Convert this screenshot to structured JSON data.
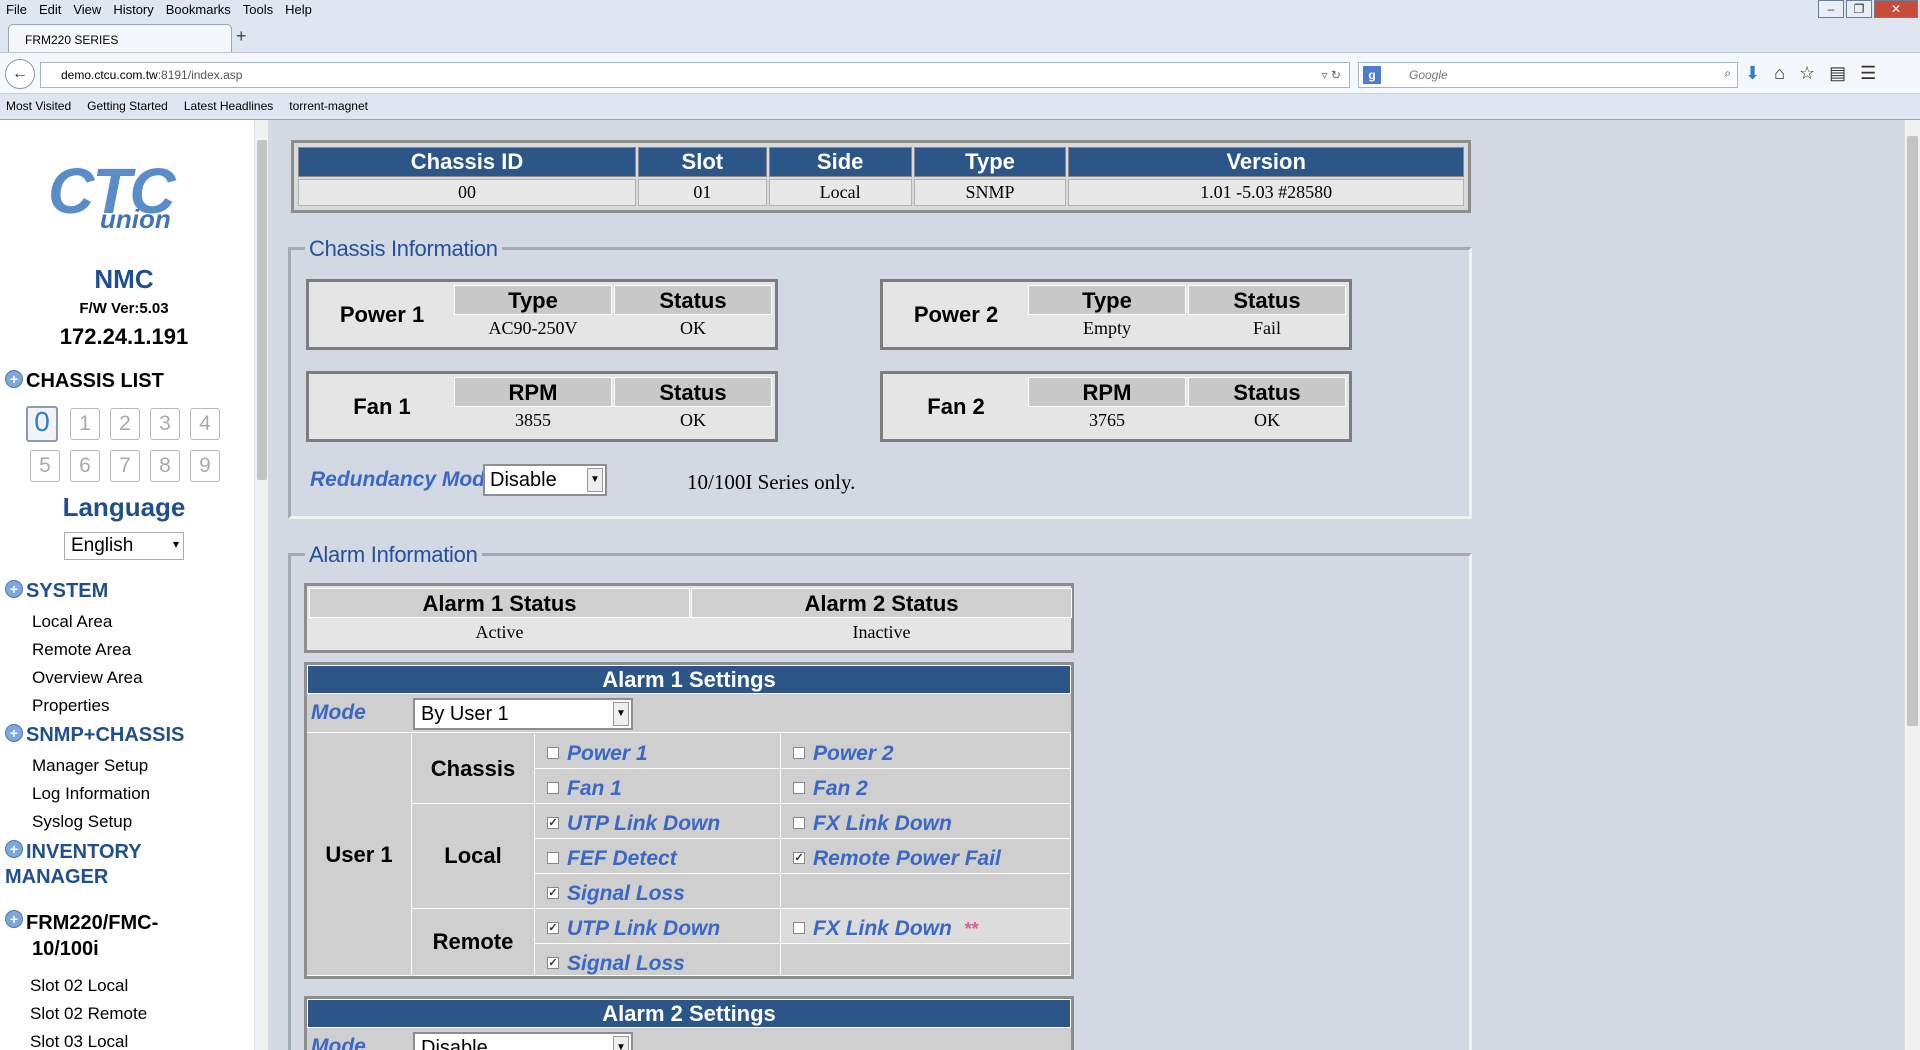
{
  "browser": {
    "menu": [
      "File",
      "Edit",
      "View",
      "History",
      "Bookmarks",
      "Tools",
      "Help"
    ],
    "tab_title": "FRM220 SERIES",
    "url_host": "demo.ctcu.com.tw",
    "url_rest": ":8191/index.asp",
    "search_placeholder": "Google",
    "bookmarks": [
      "Most Visited",
      "Getting Started",
      "Latest Headlines",
      "torrent-magnet"
    ]
  },
  "sidebar": {
    "logo_top": "CTC",
    "logo_bottom": "union",
    "nmc": "NMC",
    "fw": "F/W Ver:5.03",
    "ip": "172.24.1.191",
    "chassis_list": "CHASSIS LIST",
    "chassis_numbers": [
      "0",
      "1",
      "2",
      "3",
      "4",
      "5",
      "6",
      "7",
      "8",
      "9"
    ],
    "language_title": "Language",
    "language_value": "English",
    "system": "SYSTEM",
    "system_items": [
      "Local Area",
      "Remote Area",
      "Overview Area",
      "Properties"
    ],
    "snmp": "SNMP+CHASSIS",
    "snmp_items": [
      "Manager Setup",
      "Log Information",
      "Syslog Setup"
    ],
    "inventory_line1": "INVENTORY",
    "inventory_line2": "MANAGER",
    "frm_line1": "FRM220/FMC-",
    "frm_line2": "10/100i",
    "frm_items": [
      "Slot 02 Local",
      "Slot 02 Remote",
      "Slot 03 Local"
    ]
  },
  "header_table": {
    "headers": [
      "Chassis ID",
      "Slot",
      "Side",
      "Type",
      "Version"
    ],
    "values": [
      "00",
      "01",
      "Local",
      "SNMP",
      "1.01 -5.03 #28580"
    ]
  },
  "chassis_info": {
    "legend": "Chassis Information",
    "power1": {
      "name": "Power 1",
      "h1": "Type",
      "h2": "Status",
      "v1": "AC90-250V",
      "v2": "OK"
    },
    "power2": {
      "name": "Power 2",
      "h1": "Type",
      "h2": "Status",
      "v1": "Empty",
      "v2": "Fail"
    },
    "fan1": {
      "name": "Fan 1",
      "h1": "RPM",
      "h2": "Status",
      "v1": "3855",
      "v2": "OK"
    },
    "fan2": {
      "name": "Fan 2",
      "h1": "RPM",
      "h2": "Status",
      "v1": "3765",
      "v2": "OK"
    },
    "redundancy_label": "Redundancy Mode",
    "redundancy_value": "Disable",
    "redundancy_note": "10/100I Series only."
  },
  "alarm_info": {
    "legend": "Alarm Information",
    "alarm1_status_h": "Alarm 1 Status",
    "alarm2_status_h": "Alarm 2 Status",
    "alarm1_status": "Active",
    "alarm2_status": "Inactive",
    "alarm1_settings": {
      "title": "Alarm 1 Settings",
      "mode_label": "Mode",
      "mode_value": "By User 1",
      "user": "User 1",
      "chassis": "Chassis",
      "local": "Local",
      "remote": "Remote",
      "power1": "Power 1",
      "power2": "Power 2",
      "fan1": "Fan 1",
      "fan2": "Fan 2",
      "utp_link_down": "UTP Link Down",
      "fx_link_down": "FX Link Down",
      "fef_detect": "FEF Detect",
      "remote_power_fail": "Remote Power Fail",
      "signal_loss": "Signal Loss",
      "r_utp_link_down": "UTP Link Down",
      "r_fx_link_down": "FX Link Down",
      "r_stars": "**",
      "r_signal_loss": "Signal Loss"
    },
    "alarm2_settings": {
      "title": "Alarm 2 Settings",
      "mode_label": "Mode",
      "mode_value": "Disable"
    }
  }
}
